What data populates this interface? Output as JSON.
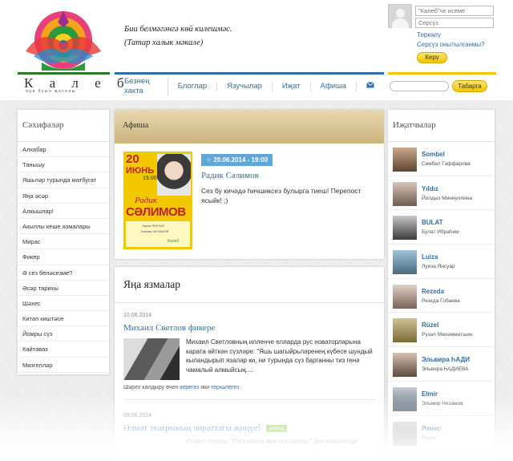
{
  "header": {
    "logo_word": "К а л е б",
    "logo_sub": "яңа буын җисены",
    "quote_line1": "Бии белмәгәнгә көй килешмәс.",
    "quote_line2": "(Татар халык мәкале)"
  },
  "nav": {
    "items": [
      "Безнең хакта",
      "Блоглар",
      "Язучылар",
      "Иҗат",
      "Афиша"
    ],
    "mail_icon": "envelope-icon"
  },
  "login": {
    "username_placeholder": "\"Калеб\"че исеме",
    "password_placeholder": "Серсүз",
    "register_link": "Теркәлү",
    "forgot_link": "Серсүз онытылганмы?",
    "login_button": "Керү"
  },
  "search": {
    "button": "Табарга"
  },
  "sidebar": {
    "title": "Сәхифәләр",
    "items": [
      "Алхабар",
      "Танышу",
      "Яшьләр турында матбугат",
      "Яңа әсәр",
      "Алкышлар!",
      "Акыллы кеше язмалары",
      "Мирас",
      "Фикер",
      "Ә сез беләсезме?",
      "Әсәр тарихы",
      "Шәхес",
      "Китап киштәсе",
      "Йомры сүз",
      "Кайтаваз",
      "Мизгелләр"
    ]
  },
  "afisha": {
    "title": "Афиша",
    "poster": {
      "day": "20",
      "month": "ИЮНЬ",
      "time": "19.00",
      "name1": "Радик",
      "name2": "СӘЛИМОВ",
      "guest1": "Луиза ЯНСУАР",
      "guest2": "Эльмир НИЗАМОВ",
      "brand": "Калеб"
    },
    "event_date": "20.06.2014 - 19:00",
    "event_title": "Радик Сәлимов",
    "event_desc": "Сез бу кичәдә һичшиксез булырга тиеш! Перепост ясыйк! ;)"
  },
  "news": {
    "title": "Яңа язмалар",
    "items": [
      {
        "date": "10.06.2014",
        "title": "Михаил Светлов фикере",
        "text": "Михаил Светловның илленче елларда рус новаторларына карата әйткән сүзләре: \"Яшь шагыйрьләренең күбесе шундый кыландырып язалар ки, ни турында сүз барганны тиз генә чамалый алмыйсың....",
        "foot_prefix": "Шәрех калдыру өчен ",
        "foot_link1": "керегез",
        "foot_mid": " яки ",
        "foot_link2": "теркәлегез",
        "foot_suffix": "."
      },
      {
        "date": "09.06.2014",
        "title": "Әлмәт театрының чираттагы җиңүе!",
        "badge": "Afisha",
        "text": "Әлмәт театры \"Россиянең яңа театрлары\" фестивалендә"
      }
    ]
  },
  "writers": {
    "title": "Иҗатчылар",
    "items": [
      {
        "nick": "Sombel",
        "name": "Сөмбел Гаффарова"
      },
      {
        "nick": "Yıldız",
        "name": "Йолдыз Миннуллина"
      },
      {
        "nick": "BULAT",
        "name": "Булат Ибраһим"
      },
      {
        "nick": "Luiza",
        "name": "Луиза Янсуар"
      },
      {
        "nick": "Rezeda",
        "name": "Резеда Гобаева"
      },
      {
        "nick": "Rüzel",
        "name": "Рүзәл Мөхәммәтшин"
      },
      {
        "nick": "Эльвира ҺАДИ",
        "name": "Эльвира ҺАДИЕВА"
      },
      {
        "nick": "Elmir",
        "name": "Эльмир Низамов"
      },
      {
        "nick": "Ранис",
        "name": "Ранис"
      }
    ]
  },
  "colors": {
    "link": "#2d6fb0",
    "accent_yellow": "#f5c300",
    "date_badge": "#5fa7d8"
  }
}
